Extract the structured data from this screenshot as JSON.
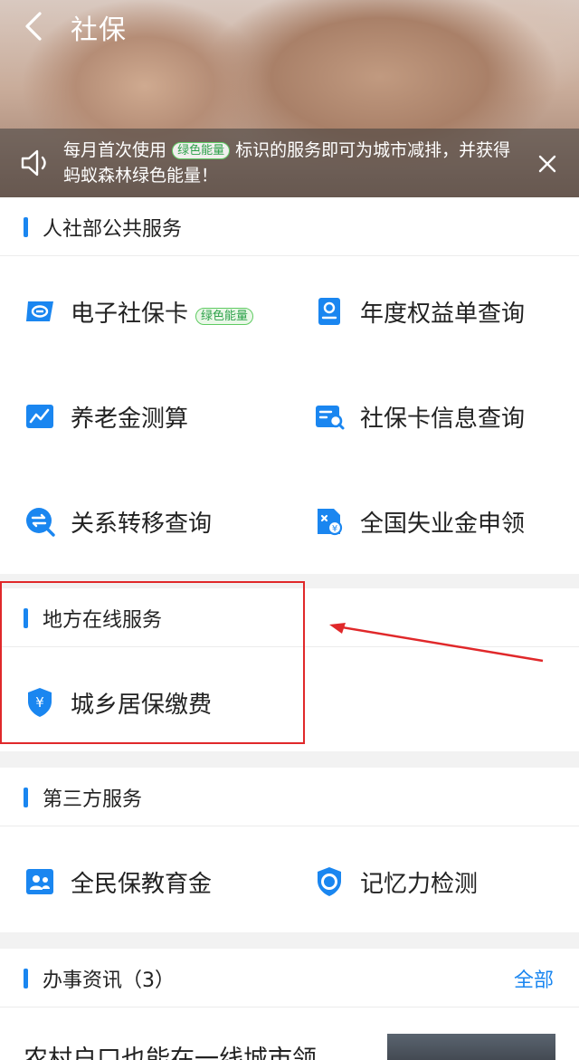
{
  "header": {
    "title": "社保",
    "back_icon": "chevron-left-icon"
  },
  "notice": {
    "text_before": "每月首次使用",
    "tag": "绿色能量",
    "text_after": "标识的服务即可为城市减排，并获得蚂蚁森林绿色能量！",
    "speaker_icon": "speaker-icon",
    "close_icon": "close-icon"
  },
  "sections": {
    "public": {
      "title": "人社部公共服务",
      "items": [
        {
          "label": "电子社保卡",
          "tag": "绿色能量",
          "icon": "social-security-card-icon"
        },
        {
          "label": "年度权益单查询",
          "icon": "annual-statement-icon"
        },
        {
          "label": "养老金测算",
          "icon": "pension-chart-icon"
        },
        {
          "label": "社保卡信息查询",
          "icon": "card-search-icon"
        },
        {
          "label": "关系转移查询",
          "icon": "transfer-icon"
        },
        {
          "label": "全国失业金申领",
          "icon": "unemployment-benefit-icon"
        }
      ]
    },
    "local": {
      "title": "地方在线服务",
      "items": [
        {
          "label": "城乡居保缴费",
          "icon": "shield-yuan-icon"
        }
      ]
    },
    "third": {
      "title": "第三方服务",
      "items": [
        {
          "label": "全民保教育金",
          "icon": "education-fund-icon"
        },
        {
          "label": "记忆力检测",
          "icon": "memory-test-icon"
        }
      ]
    },
    "news": {
      "title": "办事资讯（3）",
      "more": "全部",
      "first_title": "农村户口也能在一线城市领"
    }
  },
  "colors": {
    "accent": "#1a86f0",
    "green_tag": "#2ea24b",
    "annotation": "#e0282a"
  }
}
